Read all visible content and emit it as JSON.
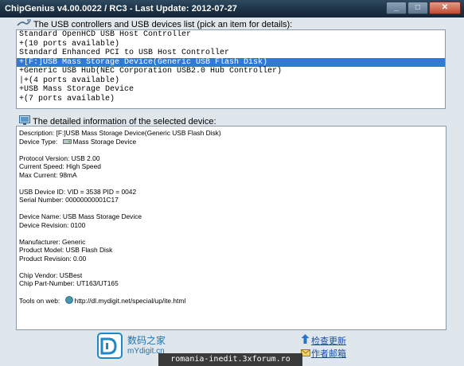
{
  "window": {
    "title": "ChipGenius v4.00.0022 / RC3 - Last Update: 2012-07-27",
    "minimize_glyph": "_",
    "maximize_glyph": "□",
    "close_glyph": "✕"
  },
  "devices_section": {
    "label": "The USB controllers and USB devices list (pick an item for details):",
    "icon": "usb-cable-icon",
    "items": [
      "Standard OpenHCD USB Host Controller",
      "+(10 ports available)",
      "Standard Enhanced PCI to USB Host Controller",
      "+[F:]USB Mass Storage Device(Generic USB Flash Disk)",
      "+Generic USB Hub(NEC Corporation USB2.0 Hub Controller)",
      "|+(4 ports available)",
      "+USB Mass Storage Device",
      "+(7 ports available)"
    ],
    "selected_index": 3
  },
  "details_section": {
    "label": "The detailed information of the selected device:",
    "icon": "monitor-icon",
    "description": "Description: [F:]USB Mass Storage Device(Generic USB Flash Disk)",
    "device_type_label": "Device Type:",
    "device_type_value": "Mass Storage Device",
    "device_type_icon": "drive-icon",
    "protocol_version": "Protocol Version: USB 2.00",
    "current_speed": "Current Speed: High Speed",
    "max_current": "Max Current: 98mA",
    "device_id": "USB Device ID: VID = 3538 PID = 0042",
    "serial_number": "Serial Number: 00000000001C17",
    "device_name": "Device Name: USB Mass Storage Device",
    "device_revision": "Device Revision: 0100",
    "manufacturer": "Manufacturer: Generic",
    "product_model": "Product Model: USB Flash Disk",
    "product_revision": "Product Revision: 0.00",
    "chip_vendor": "Chip Vendor: USBest",
    "chip_part_number": "Chip Part-Number: UT163/UT165",
    "tools_label": "Tools on web:",
    "tools_url": "http://dl.mydigit.net/special/up/ite.html",
    "tools_icon": "globe-icon"
  },
  "footer": {
    "logo_icon": "mydigit-logo-icon",
    "logo_text": "数码之家",
    "logo_site": "mYdigit.cn",
    "check_update": "检查更新",
    "check_update_icon": "update-arrow-icon",
    "author_mail": "作者邮箱",
    "author_mail_icon": "mail-icon"
  },
  "watermark": "romania-inedit.3xforum.ro",
  "colors": {
    "titlebar": "#1d3245",
    "selection": "#3378d1",
    "link": "#1c4fa3",
    "brand": "#1a74b8"
  }
}
